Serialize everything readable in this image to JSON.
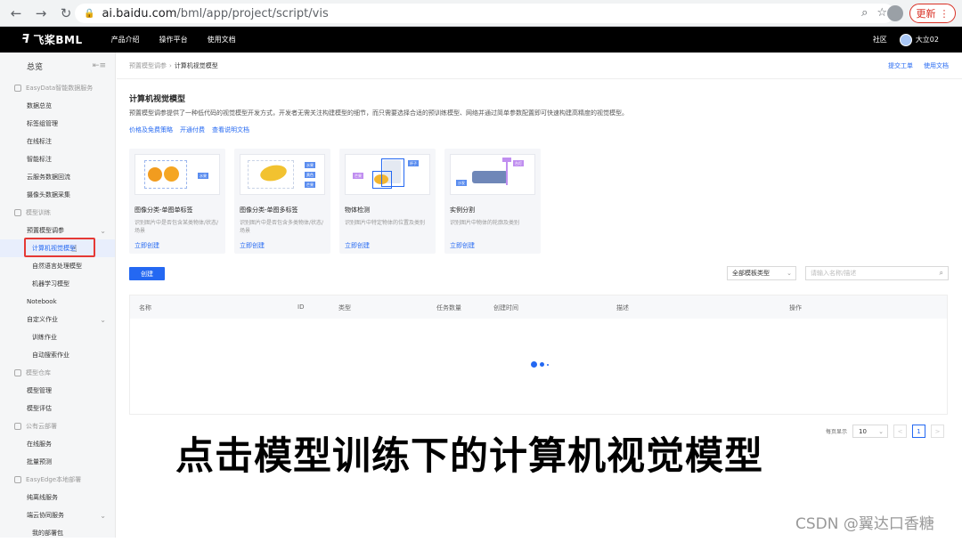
{
  "browser": {
    "url_host": "ai.baidu.com",
    "url_path": "/bml/app/project/script/vis",
    "update_label": "更新"
  },
  "appbar": {
    "logo_text": "飞桨BML",
    "nav": [
      "产品介绍",
      "操作平台",
      "使用文档"
    ],
    "community": "社区",
    "username": "大立02"
  },
  "sidebar": {
    "overview": "总览",
    "groups": [
      {
        "label": "EasyData智能数据服务",
        "items": [
          "数据总览",
          "标签组管理",
          "在线标注",
          "智能标注",
          "云服务数据回流",
          "摄像头数据采集"
        ]
      },
      {
        "label": "模型训练",
        "items": [
          "预置模型调参",
          "计算机视觉模型",
          "自然语言处理模型",
          "机器学习模型",
          "Notebook",
          "自定义作业",
          "训练作业",
          "自动搜索作业"
        ]
      },
      {
        "label": "模型仓库",
        "items": [
          "模型管理",
          "模型评估"
        ]
      },
      {
        "label": "公有云部署",
        "items": [
          "在线服务",
          "批量预测"
        ]
      },
      {
        "label": "EasyEdge本地部署",
        "items": [
          "纯离线服务",
          "端云协同服务",
          "我的部署包"
        ]
      }
    ]
  },
  "breadcrumb": {
    "parent": "预置模型调参",
    "current": "计算机视觉模型",
    "links": [
      "提交工单",
      "使用文档"
    ]
  },
  "page": {
    "title": "计算机视觉模型",
    "description": "预置模型调参提供了一种低代码的视觉模型开发方式，开发者无需关注构建模型的细节，而只需要选择合适的预训练模型、网络并通过简单参数配置即可快速构建高精度的视觉模型。",
    "links": [
      "价格及免费策略",
      "开通付费",
      "查看说明文档"
    ]
  },
  "cards": [
    {
      "title": "图像分类-单图单标签",
      "desc": "识别图片中是否包含某类物体/状态/场景",
      "link": "立即创建",
      "tags": [
        "水果"
      ]
    },
    {
      "title": "图像分类-单图多标签",
      "desc": "识别图片中是否包含多类物体/状态/场景",
      "link": "立即创建",
      "tags": [
        "水果",
        "黄色",
        "芒果"
      ]
    },
    {
      "title": "物体检测",
      "desc": "识别图片中特定物体的位置及类别",
      "link": "立即创建",
      "tags": [
        "芒果",
        "杯子"
      ]
    },
    {
      "title": "实例分割",
      "desc": "识别图片中物体的轮廓及类别",
      "link": "立即创建",
      "tags": [
        "沙发",
        "台灯"
      ]
    }
  ],
  "toolbar": {
    "create_label": "创建",
    "type_select": "全部模板类型",
    "search_placeholder": "请输入名称/描述"
  },
  "table": {
    "headers": [
      "名称",
      "ID",
      "类型",
      "任务数量",
      "创建时间",
      "描述",
      "操作"
    ]
  },
  "pager": {
    "label": "每页显示",
    "page_size": "10",
    "current_page": "1",
    "prev": "<",
    "next": ">"
  },
  "caption": "点击模型训练下的计算机视觉模型",
  "watermark": "CSDN @翼达口香糖",
  "colors": {
    "accent": "#2468f2",
    "highlight": "#e53935"
  }
}
